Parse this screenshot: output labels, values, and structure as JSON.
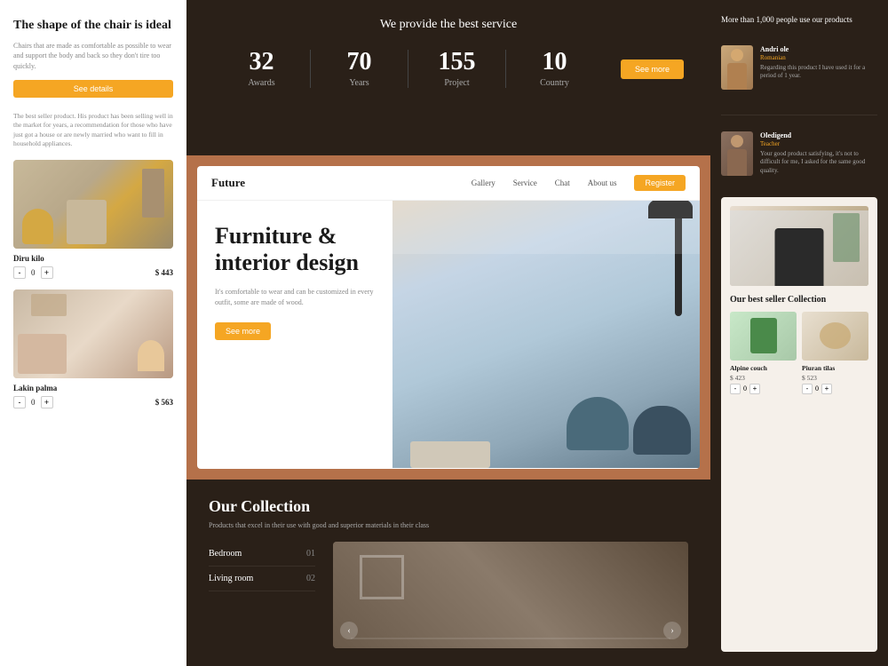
{
  "left": {
    "title": "The shape of the chair is ideal",
    "description": "Chairs that are made as comfortable as possible to wear and support the body and back so they don't tire too quickly.",
    "see_details": "See details",
    "product_desc": "The best seller product. His product has been selling well in the market for years, a recommendation for those who have just got a house or are newly married who want to fill in household appliances.",
    "products": [
      {
        "name": "Diru kilo",
        "price": "$ 443",
        "qty": 0
      },
      {
        "name": "Lakin palma",
        "price": "$ 563",
        "qty": 0
      }
    ]
  },
  "stats": {
    "title": "We provide the best service",
    "items": [
      {
        "number": "32",
        "label": "Awards"
      },
      {
        "number": "70",
        "label": "Years"
      },
      {
        "number": "155",
        "label": "Project"
      },
      {
        "number": "10",
        "label": "Country"
      }
    ],
    "see_more": "See more"
  },
  "furniture": {
    "nav": {
      "logo": "Future",
      "links": [
        "Gallery",
        "Service",
        "Chat",
        "About us"
      ],
      "register": "Register"
    },
    "headline": "Furniture & interior design",
    "sub": "It's comfortable to wear and can be customized in every outfit, some are made of wood.",
    "see_more": "See more"
  },
  "collection": {
    "title": "Our Collection",
    "description": "Products that excel in their use with good and superior materials in their class",
    "menu": [
      {
        "label": "Bedroom",
        "num": "01"
      },
      {
        "label": "Living room",
        "num": "02"
      }
    ]
  },
  "right": {
    "top_text": "More than 1,000 people use our products",
    "testimonials": [
      {
        "name": "Andri ole",
        "role": "Romanian",
        "body": "Regarding this product I have used it for a period of 1 year."
      },
      {
        "name": "Oledigend",
        "role": "Teacher",
        "body": "Your good product satisfying, it's not to difficult for me, I asked for the same good quality."
      }
    ],
    "chair_section_title": "Our best seller Collection",
    "best_sellers": [
      {
        "name": "Alpine couch",
        "price": "$ 423"
      },
      {
        "name": "Piuran tilas",
        "price": "$ 523"
      }
    ]
  }
}
